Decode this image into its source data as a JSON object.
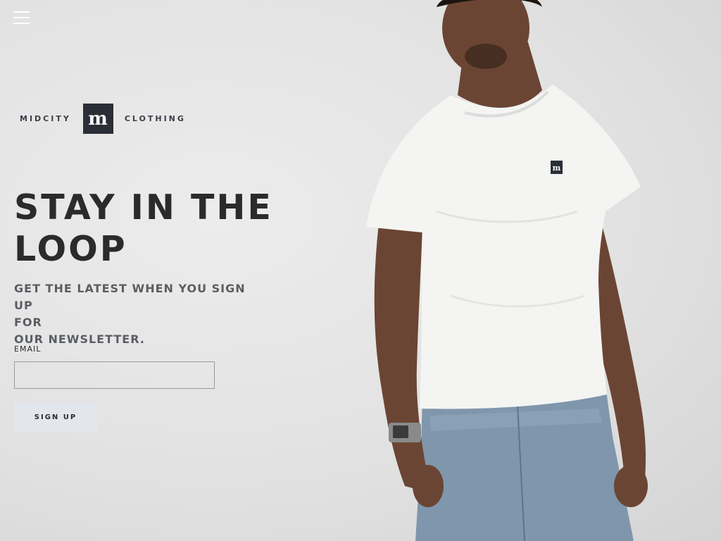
{
  "nav": {
    "menu_icon": "hamburger-menu-icon"
  },
  "brand": {
    "left_word": "MIDCITY",
    "right_word": "CLOTHING",
    "mark_letter": "m",
    "mark_color": "#2a2f37"
  },
  "hero": {
    "headline_line1": "STAY IN THE",
    "headline_line2": "LOOP",
    "subhead_line1": "GET THE LATEST WHEN YOU SIGN UP",
    "subhead_line2": "FOR",
    "subhead_line3": "OUR NEWSLETTER."
  },
  "form": {
    "email_label": "EMAIL",
    "email_value": "",
    "email_placeholder": "",
    "submit_label": "SIGN UP"
  },
  "colors": {
    "text_dark": "#2b2b2b",
    "button_bg": "#e3e6ec",
    "background": "#e6e6e6"
  }
}
